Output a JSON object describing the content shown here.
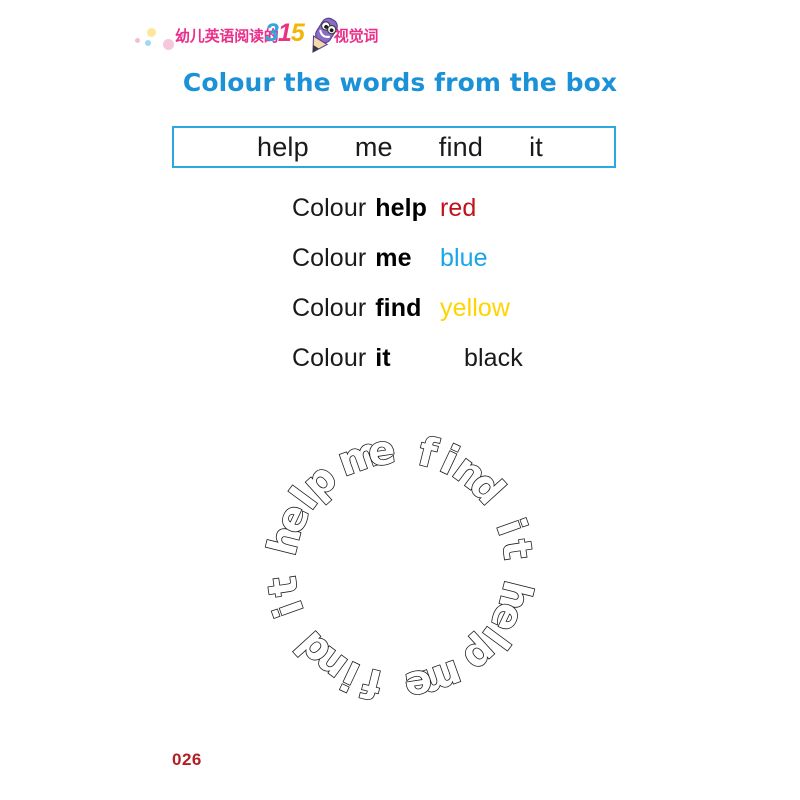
{
  "brand": {
    "text_left": "幼儿英语阅读的",
    "number": "315",
    "text_right": "个视觉词",
    "mascot_icon": "pencil-mascot-icon",
    "colors": {
      "pink": "#ec2d8a",
      "blue": "#2ea8e0",
      "magenta": "#e8357e",
      "yellow": "#f2b705",
      "mascot_purple": "#8a6cc4"
    }
  },
  "title": "Colour the words from the box",
  "title_color": "#1b91d8",
  "word_box": {
    "border_color": "#2aa9e0",
    "words": [
      "help",
      "me",
      "find",
      "it"
    ]
  },
  "instructions": [
    {
      "prefix": "Colour",
      "word": "help",
      "colour_name": "red",
      "colour_hex": "#c1121c"
    },
    {
      "prefix": "Colour",
      "word": "me",
      "colour_name": "blue",
      "colour_hex": "#19a5e6"
    },
    {
      "prefix": "Colour",
      "word": "find",
      "colour_name": "yellow",
      "colour_hex": "#ffd400"
    },
    {
      "prefix": "Colour",
      "word": "it",
      "colour_name": "black",
      "colour_hex": "#1a1a1a"
    }
  ],
  "ring": {
    "style": "outline-bubble-letters",
    "description": "Circle of hollow outlined letters, phrase repeated twice clockwise",
    "phrase": "help me find it",
    "repetitions": 2,
    "letters_clockwise": "help me find it help me find it",
    "outline_color": "#1a1a1a",
    "fill_color": "#ffffff"
  },
  "page_number": "026",
  "page_number_color": "#b01f24"
}
